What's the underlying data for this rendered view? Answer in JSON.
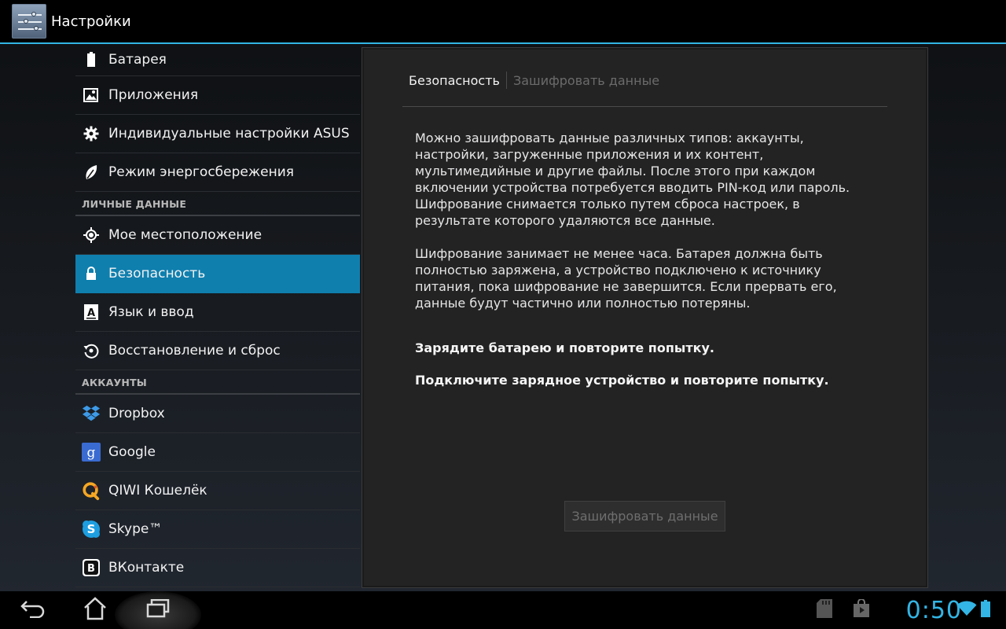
{
  "app": {
    "title": "Настройки"
  },
  "sidebar": {
    "device_items": [
      {
        "label": "Батарея",
        "icon": "battery-icon"
      },
      {
        "label": "Приложения",
        "icon": "apps-icon"
      },
      {
        "label": "Индивидуальные настройки ASUS",
        "icon": "gear-icon"
      },
      {
        "label": "Режим энергосбережения",
        "icon": "leaf-icon"
      }
    ],
    "personal_header": "ЛИЧНЫЕ ДАННЫЕ",
    "personal_items": [
      {
        "label": "Мое местоположение",
        "icon": "location-icon"
      },
      {
        "label": "Безопасность",
        "icon": "lock-icon",
        "selected": true
      },
      {
        "label": "Язык и ввод",
        "icon": "keyboard-icon"
      },
      {
        "label": "Восстановление и сброс",
        "icon": "restore-icon"
      }
    ],
    "accounts_header": "АККАУНТЫ",
    "account_items": [
      {
        "label": "Dropbox",
        "icon": "dropbox-icon"
      },
      {
        "label": "Google",
        "icon": "google-icon"
      },
      {
        "label": "QIWI Кошелёк",
        "icon": "qiwi-icon"
      },
      {
        "label": "Skype™",
        "icon": "skype-icon"
      },
      {
        "label": "ВКонтакте",
        "icon": "vk-icon"
      }
    ]
  },
  "panel": {
    "breadcrumb_current": "Безопасность",
    "breadcrumb_next": "Зашифровать данные",
    "paragraph1": "Можно зашифровать данные различных типов: аккаунты, настройки, загруженные приложения и их контент, мультимедийные и другие файлы. После этого при каждом включении устройства потребуется вводить PIN-код или пароль. Шифрование снимается только путем сброса настроек, в результате которого удаляются все данные.",
    "paragraph2": "Шифрование занимает не менее часа. Батарея должна быть полностью заряжена, а устройство подключено к источнику питания, пока шифрование не завершится. Если прервать его, данные будут частично или полностью потеряны.",
    "warning_battery": "Зарядите батарею и повторите попытку.",
    "warning_charger": "Подключите зарядное устройство и повторите попытку.",
    "encrypt_button": "Зашифровать данные"
  },
  "system_bar": {
    "time": "0:50",
    "accent": "#33b5e5",
    "selection_color": "#0f7fae"
  }
}
